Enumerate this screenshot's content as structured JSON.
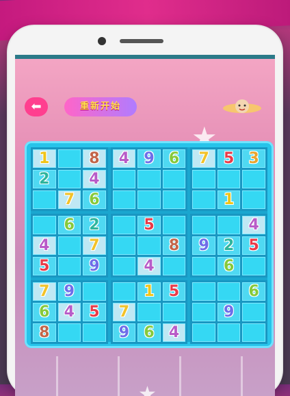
{
  "header": {
    "back_icon": "back-arrow-icon",
    "restart_label": "重新开始",
    "logo_icon": "monkey-king-logo"
  },
  "colors": {
    "banner": "#c2187d",
    "board": "#27c4ea",
    "back_button": "#ff3f8f"
  },
  "board": {
    "rows": [
      [
        "1",
        "",
        "8",
        "4",
        "9",
        "6",
        "7",
        "5",
        "3"
      ],
      [
        "2",
        "",
        "4",
        "",
        "",
        "",
        "",
        "",
        ""
      ],
      [
        "",
        "7",
        "6",
        "",
        "",
        "",
        "",
        "1",
        ""
      ],
      [
        "",
        "6",
        "2",
        "",
        "5",
        "",
        "",
        "",
        "4"
      ],
      [
        "4",
        "",
        "7",
        "",
        "",
        "8",
        "9",
        "2",
        "5"
      ],
      [
        "5",
        "",
        "9",
        "",
        "4",
        "",
        "",
        "6",
        ""
      ],
      [
        "7",
        "9",
        "",
        "",
        "1",
        "5",
        "",
        "",
        "6"
      ],
      [
        "6",
        "4",
        "5",
        "7",
        "",
        "",
        "",
        "9",
        ""
      ],
      [
        "8",
        "",
        "",
        "9",
        "6",
        "4",
        "",
        "",
        ""
      ]
    ],
    "given": [
      [
        1,
        0,
        1,
        1,
        0,
        0,
        1,
        0,
        0
      ],
      [
        0,
        0,
        1,
        0,
        0,
        0,
        0,
        0,
        0
      ],
      [
        0,
        1,
        0,
        0,
        0,
        0,
        0,
        0,
        0
      ],
      [
        0,
        0,
        0,
        0,
        0,
        0,
        0,
        0,
        1
      ],
      [
        1,
        0,
        1,
        0,
        0,
        0,
        0,
        0,
        0
      ],
      [
        0,
        0,
        0,
        0,
        1,
        0,
        0,
        0,
        0
      ],
      [
        1,
        0,
        0,
        0,
        0,
        0,
        0,
        0,
        0
      ],
      [
        0,
        1,
        0,
        1,
        0,
        0,
        0,
        0,
        0
      ],
      [
        0,
        0,
        0,
        0,
        0,
        1,
        0,
        0,
        0
      ]
    ]
  }
}
